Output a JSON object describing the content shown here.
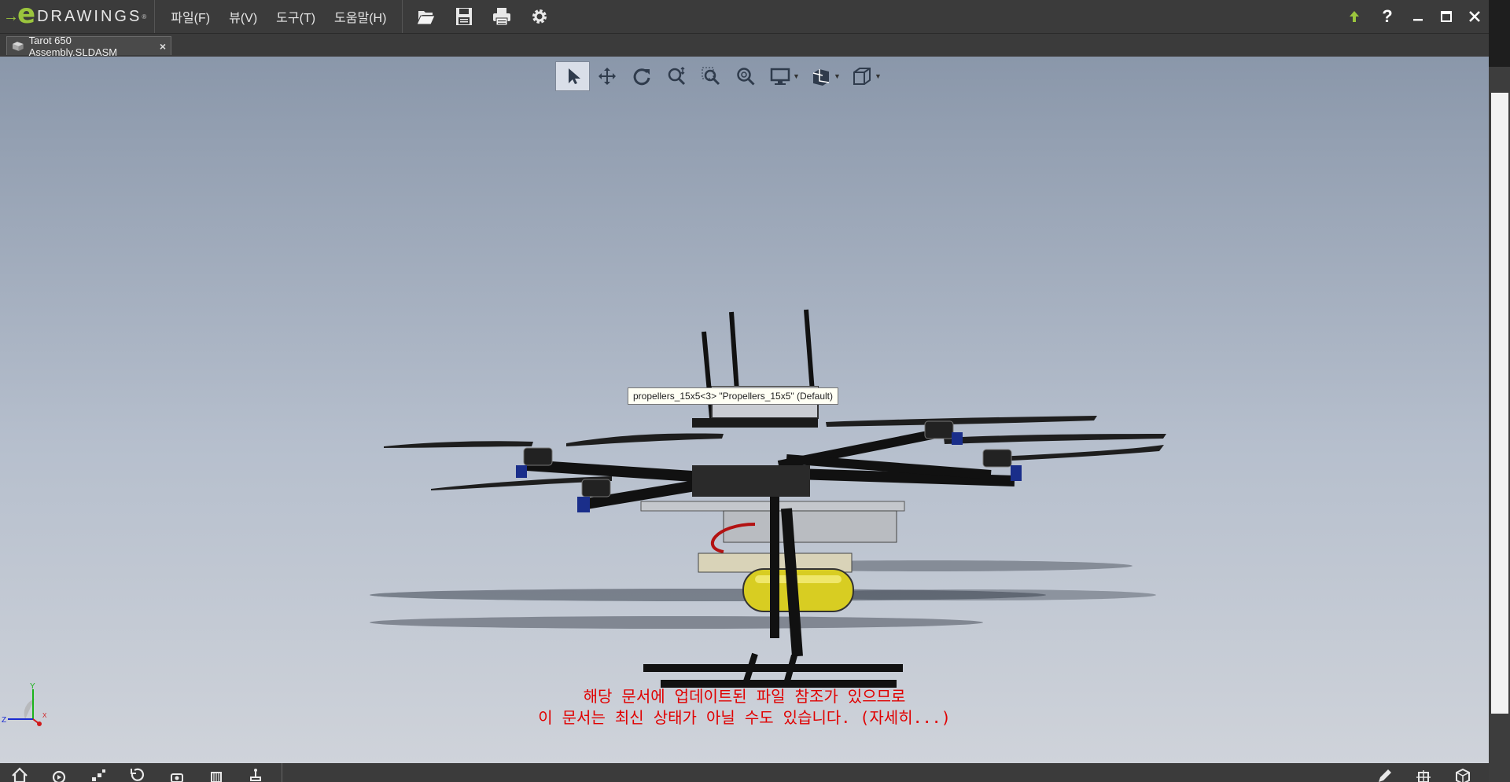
{
  "app": {
    "logo_word": "DRAWINGS",
    "logo_letter": "e",
    "logo_reg": "®"
  },
  "menu": [
    {
      "label": "파일(F)"
    },
    {
      "label": "뷰(V)"
    },
    {
      "label": "도구(T)"
    },
    {
      "label": "도움말(H)"
    }
  ],
  "toolbar": {
    "icons": [
      "open-file-icon",
      "save-icon",
      "print-icon",
      "settings-icon"
    ]
  },
  "title_controls": {
    "upload_icon": "upload-arrow-icon",
    "help_label": "?"
  },
  "tab": {
    "label": "Tarot 650 Assembly.SLDASM",
    "close": "×"
  },
  "view_toolbar": {
    "tools": [
      "select-icon",
      "pan-icon",
      "rotate-icon",
      "zoom-icon",
      "zoom-to-area-icon",
      "zoom-to-fit-icon",
      "display-style-icon",
      "section-view-icon",
      "standard-views-icon"
    ]
  },
  "viewport": {
    "tooltip": "propellers_15x5<3> \"Propellers_15x5\" (Default)",
    "warning_line1": "해당 문서에 업데이트된 파일 참조가 있으므로",
    "warning_line2": "이 문서는 최신 상태가 아닐 수도 있습니다. (자세히...)",
    "triad_x": "X",
    "triad_y": "Y",
    "triad_z": "Z"
  },
  "colors": {
    "accent_green": "#9bc53d",
    "warning_red": "#e00000",
    "chrome_dark": "#3b3b3b"
  }
}
